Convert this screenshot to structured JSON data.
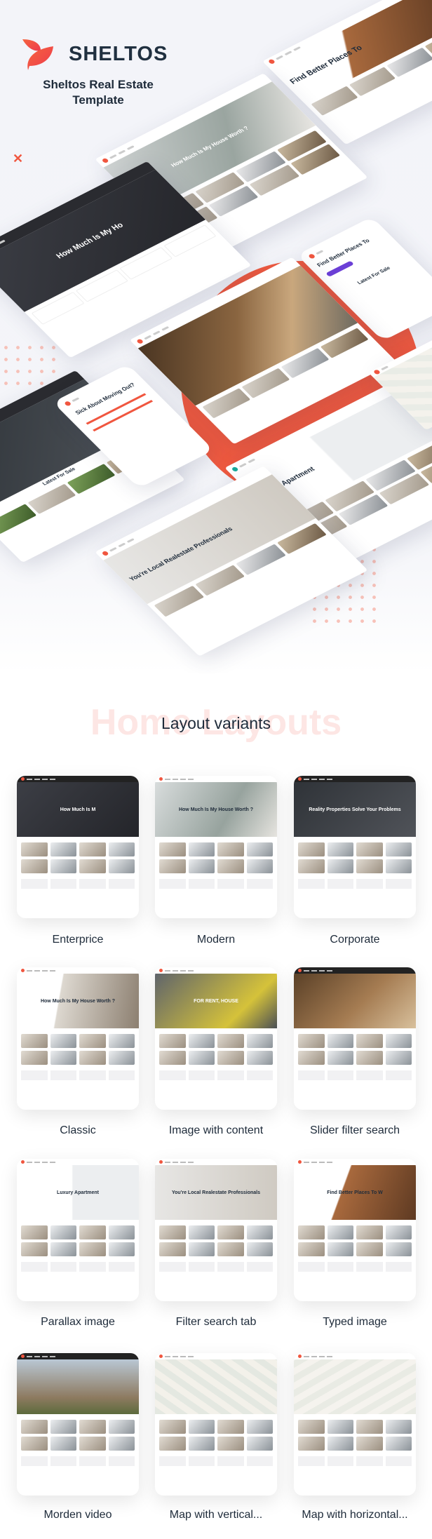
{
  "brand": {
    "name": "SHELTOS",
    "tagline": "Sheltos Real Estate Template",
    "accent": "#ef5a40"
  },
  "hero_mockups": {
    "enterprise_headline": "How Much Is My Ho",
    "modern_headline": "How Much Is My House Worth ?",
    "typed_headline": "Find Better Places To",
    "phone_headline": "Find Better Places To",
    "phone_subtitle": "Latest For Sale",
    "slider_headline": "Sick About Moving Out?",
    "parallax_headline": "Luxury Apartment",
    "filter_headline": "You're Local Realestate Professionals",
    "corporate_subtitle": "Latest For Sale"
  },
  "section": {
    "watermark": "Home Layouts",
    "title": "Layout variants"
  },
  "variants": [
    {
      "label": "Enterprice",
      "headline": "How Much Is M"
    },
    {
      "label": "Modern",
      "headline": "How Much Is My House Worth ?"
    },
    {
      "label": "Corporate",
      "headline": "Reality Properties Solve Your Problems"
    },
    {
      "label": "Classic",
      "headline": "How Much Is My House Worth ?"
    },
    {
      "label": "Image with content",
      "headline": "FOR RENT, HOUSE"
    },
    {
      "label": "Slider filter search",
      "headline": ""
    },
    {
      "label": "Parallax image",
      "headline": "Luxury Apartment"
    },
    {
      "label": "Filter search tab",
      "headline": "You're Local Realestate Professionals"
    },
    {
      "label": "Typed image",
      "headline": "Find Better Places To W"
    },
    {
      "label": "Morden video",
      "headline": ""
    },
    {
      "label": "Map with vertical...",
      "headline": ""
    },
    {
      "label": "Map with horizontal...",
      "headline": ""
    }
  ]
}
